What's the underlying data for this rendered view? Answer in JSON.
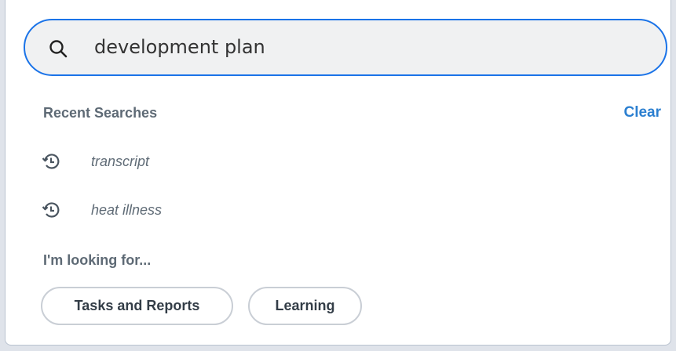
{
  "search": {
    "value": "development plan",
    "placeholder": ""
  },
  "recent": {
    "title": "Recent Searches",
    "clear_label": "Clear",
    "items": [
      {
        "label": "transcript",
        "icon": "history-icon"
      },
      {
        "label": "heat illness",
        "icon": "history-icon"
      }
    ]
  },
  "looking_for": {
    "title": "I'm looking for...",
    "chips": [
      {
        "label": "Tasks and Reports"
      },
      {
        "label": "Learning"
      }
    ]
  },
  "colors": {
    "accent": "#1a73e8",
    "link": "#2b7fd0",
    "muted_text": "#5e6a75",
    "search_bg": "#f0f1f2"
  }
}
